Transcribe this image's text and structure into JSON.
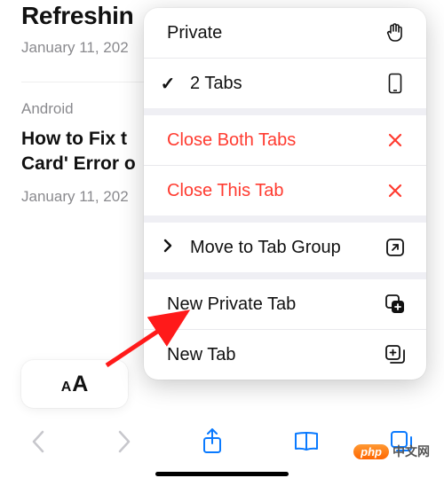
{
  "page": {
    "article1": {
      "title_visible": "Refreshin",
      "date": "January 11, 202"
    },
    "article2": {
      "category": "Android",
      "title_line1": "How to Fix t",
      "title_line2": "Card' Error o",
      "date": "January 11, 202"
    }
  },
  "menu": {
    "private": "Private",
    "tabs": "2 Tabs",
    "close_both": "Close Both Tabs",
    "close_this": "Close This Tab",
    "move_group": "Move to Tab Group",
    "new_private": "New Private Tab",
    "new_tab": "New Tab"
  },
  "watermark": {
    "badge": "php",
    "text": "中文网"
  }
}
